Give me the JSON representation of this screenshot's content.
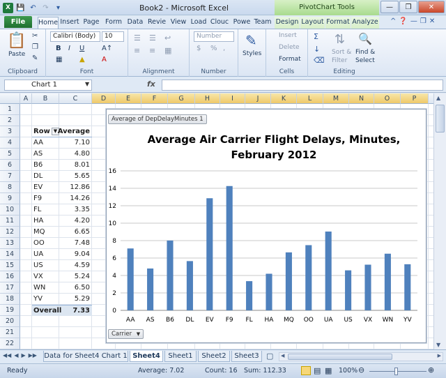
{
  "window": {
    "title": "Book2 - Microsoft Excel",
    "context_group": "PivotChart Tools"
  },
  "tabs": [
    {
      "label": "File"
    },
    {
      "label": "Home"
    },
    {
      "label": "Insert"
    },
    {
      "label": "Page"
    },
    {
      "label": "Form"
    },
    {
      "label": "Data"
    },
    {
      "label": "Revie"
    },
    {
      "label": "View"
    },
    {
      "label": "Load"
    },
    {
      "label": "Clouc"
    },
    {
      "label": "Powe"
    },
    {
      "label": "Team"
    },
    {
      "label": "Design"
    },
    {
      "label": "Layout"
    },
    {
      "label": "Format"
    },
    {
      "label": "Analyze"
    }
  ],
  "ribbon": {
    "clipboard": {
      "paste": "Paste",
      "group": "Clipboard"
    },
    "font": {
      "name": "Calibri (Body)",
      "size": "10",
      "bold": "B",
      "italic": "I",
      "underline": "U",
      "group": "Font"
    },
    "alignment": {
      "group": "Alignment"
    },
    "number": {
      "format": "Number",
      "currency": "$",
      "percent": "%",
      "comma": ",",
      "group": "Number"
    },
    "styles": {
      "label": "Styles"
    },
    "cells": {
      "insert": "Insert",
      "delete": "Delete",
      "format": "Format",
      "group": "Cells"
    },
    "editing": {
      "sort": "Sort &",
      "filter": "Filter",
      "find": "Find &",
      "select": "Select",
      "group": "Editing"
    }
  },
  "formula_bar": {
    "name_box": "Chart 1",
    "fx": "fx",
    "content": ""
  },
  "grid": {
    "columns": [
      "A",
      "B",
      "C",
      "D",
      "E",
      "F",
      "G",
      "H",
      "I",
      "J",
      "K",
      "L",
      "M",
      "N",
      "O",
      "P"
    ],
    "rows": [
      "1",
      "2",
      "3",
      "4",
      "5",
      "6",
      "7",
      "8",
      "9",
      "10",
      "11",
      "12",
      "13",
      "14",
      "15",
      "16",
      "17",
      "18",
      "19",
      "20",
      "21",
      "22"
    ]
  },
  "pivot": {
    "header_row": "Row",
    "header_value": "Average",
    "rows": [
      {
        "label": "AA",
        "value": "7.10"
      },
      {
        "label": "AS",
        "value": "4.80"
      },
      {
        "label": "B6",
        "value": "8.01"
      },
      {
        "label": "DL",
        "value": "5.65"
      },
      {
        "label": "EV",
        "value": "12.86"
      },
      {
        "label": "F9",
        "value": "14.26"
      },
      {
        "label": "FL",
        "value": "3.35"
      },
      {
        "label": "HA",
        "value": "4.20"
      },
      {
        "label": "MQ",
        "value": "6.65"
      },
      {
        "label": "OO",
        "value": "7.48"
      },
      {
        "label": "UA",
        "value": "9.04"
      },
      {
        "label": "US",
        "value": "4.59"
      },
      {
        "label": "VX",
        "value": "5.24"
      },
      {
        "label": "WN",
        "value": "6.50"
      },
      {
        "label": "YV",
        "value": "5.29"
      }
    ],
    "total_label": "Overall",
    "total_value": "7.33"
  },
  "chart_field_button": "Average of DepDelayMinutes 1",
  "chart_axis_button": "Carrier",
  "chart_data": {
    "type": "bar",
    "title_line1": "Average Air Carrier Flight Delays, Minutes,",
    "title_line2": "February 2012",
    "categories": [
      "AA",
      "AS",
      "B6",
      "DL",
      "EV",
      "F9",
      "FL",
      "HA",
      "MQ",
      "OO",
      "UA",
      "US",
      "VX",
      "WN",
      "YV"
    ],
    "values": [
      7.1,
      4.8,
      8.01,
      5.65,
      12.86,
      14.26,
      3.35,
      4.2,
      6.65,
      7.48,
      9.04,
      4.59,
      5.24,
      6.5,
      5.29
    ],
    "ylim": [
      0,
      16
    ],
    "yticks": [
      "0",
      "2",
      "4",
      "6",
      "8",
      "10",
      "12",
      "14",
      "16"
    ],
    "grid": true,
    "bar_color": "#4f81bd"
  },
  "sheet_tabs": [
    {
      "label": "Data for Sheet4 Chart 1"
    },
    {
      "label": "Sheet4"
    },
    {
      "label": "Sheet1"
    },
    {
      "label": "Sheet2"
    },
    {
      "label": "Sheet3"
    }
  ],
  "status": {
    "mode": "Ready",
    "average": "Average: 7.02",
    "count": "Count: 16",
    "sum": "Sum: 112.33",
    "zoom": "100%"
  }
}
